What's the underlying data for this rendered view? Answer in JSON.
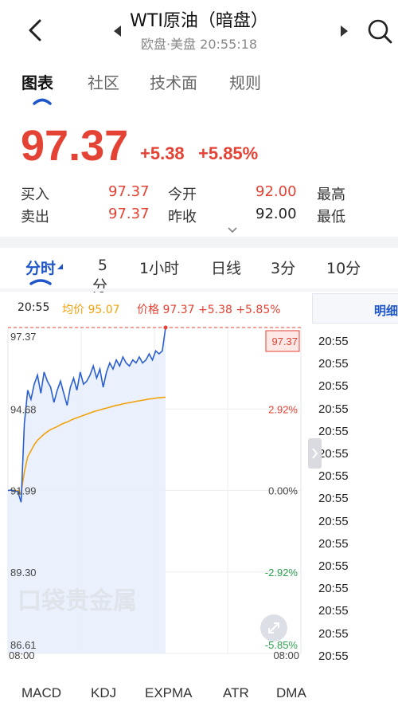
{
  "header": {
    "title": "WTI原油（暗盘）",
    "subtitle": "欧盘·美盘  20:55:18"
  },
  "tabs": [
    {
      "label": "图表",
      "active": true
    },
    {
      "label": "社区"
    },
    {
      "label": "技术面"
    },
    {
      "label": "规则"
    }
  ],
  "quote": {
    "price": "97.37",
    "change": "+5.38",
    "change_pct": "+5.85%",
    "buy_label": "买入",
    "buy_value": "97.37",
    "sell_label": "卖出",
    "sell_value": "97.37",
    "open_label": "今开",
    "open_value": "92.00",
    "prev_close_label": "昨收",
    "prev_close_value": "92.00",
    "high_label": "最高",
    "low_label": "最低"
  },
  "chart_tabs": [
    {
      "label": "分时",
      "active": true
    },
    {
      "label": "5分"
    },
    {
      "label": "1小时"
    },
    {
      "label": "日线"
    },
    {
      "label": "3分"
    },
    {
      "label": "10分"
    }
  ],
  "infobar": {
    "time": "20:55",
    "avg": "均价 95.07",
    "price": "价格 97.37 +5.38 +5.85%"
  },
  "colors": {
    "up": "#e34234",
    "down": "#2e9e4f",
    "accent": "#1e56c9",
    "avg_line": "#f2a20c"
  },
  "chart_data": {
    "type": "line",
    "x_start": "08:00",
    "x_end": "08:00",
    "y_left_ticks": [
      "97.37",
      "94.68",
      "91.99",
      "89.30",
      "86.61"
    ],
    "y_right_ticks": [
      "5.85%",
      "2.92%",
      "0.00%",
      "-2.92%",
      "-5.85%"
    ],
    "ylim": [
      86.61,
      97.37
    ],
    "series": [
      {
        "name": "价格",
        "values": [
          91.99,
          92.0,
          91.98,
          91.95,
          91.6,
          94.2,
          95.3,
          95.0,
          95.5,
          95.8,
          95.2,
          95.9,
          95.6,
          95.4,
          94.9,
          95.3,
          95.6,
          95.2,
          94.8,
          95.4,
          95.7,
          95.3,
          95.9,
          95.5,
          95.6,
          95.8,
          96.1,
          95.7,
          96.0,
          95.4,
          95.9,
          96.2,
          96.0,
          96.3,
          96.1,
          96.4,
          96.2,
          96.1,
          96.3,
          96.2,
          96.4,
          96.2,
          96.3,
          96.5,
          96.3,
          96.6,
          96.5,
          96.6,
          97.37
        ]
      },
      {
        "name": "均价",
        "values": [
          91.99,
          92.0,
          91.99,
          91.98,
          91.9,
          92.6,
          93.1,
          93.3,
          93.5,
          93.65,
          93.75,
          93.85,
          93.93,
          94.0,
          94.05,
          94.1,
          94.16,
          94.21,
          94.25,
          94.3,
          94.35,
          94.39,
          94.43,
          94.47,
          94.51,
          94.55,
          94.59,
          94.62,
          94.65,
          94.68,
          94.71,
          94.74,
          94.77,
          94.8,
          94.82,
          94.85,
          94.87,
          94.89,
          94.91,
          94.93,
          94.95,
          94.97,
          94.99,
          95.01,
          95.02,
          95.04,
          95.05,
          95.06,
          95.07
        ]
      }
    ],
    "grid": true,
    "watermark": "口袋贵金属"
  },
  "detail": {
    "header": "明细",
    "rows": [
      "20:55",
      "20:55",
      "20:55",
      "20:55",
      "20:55",
      "20:55",
      "20:55",
      "20:55",
      "20:55",
      "20:55",
      "20:55",
      "20:55",
      "20:55",
      "20:55",
      "20:55"
    ]
  },
  "indicators": [
    "MACD",
    "KDJ",
    "EXPMA",
    "ATR",
    "DMA"
  ]
}
